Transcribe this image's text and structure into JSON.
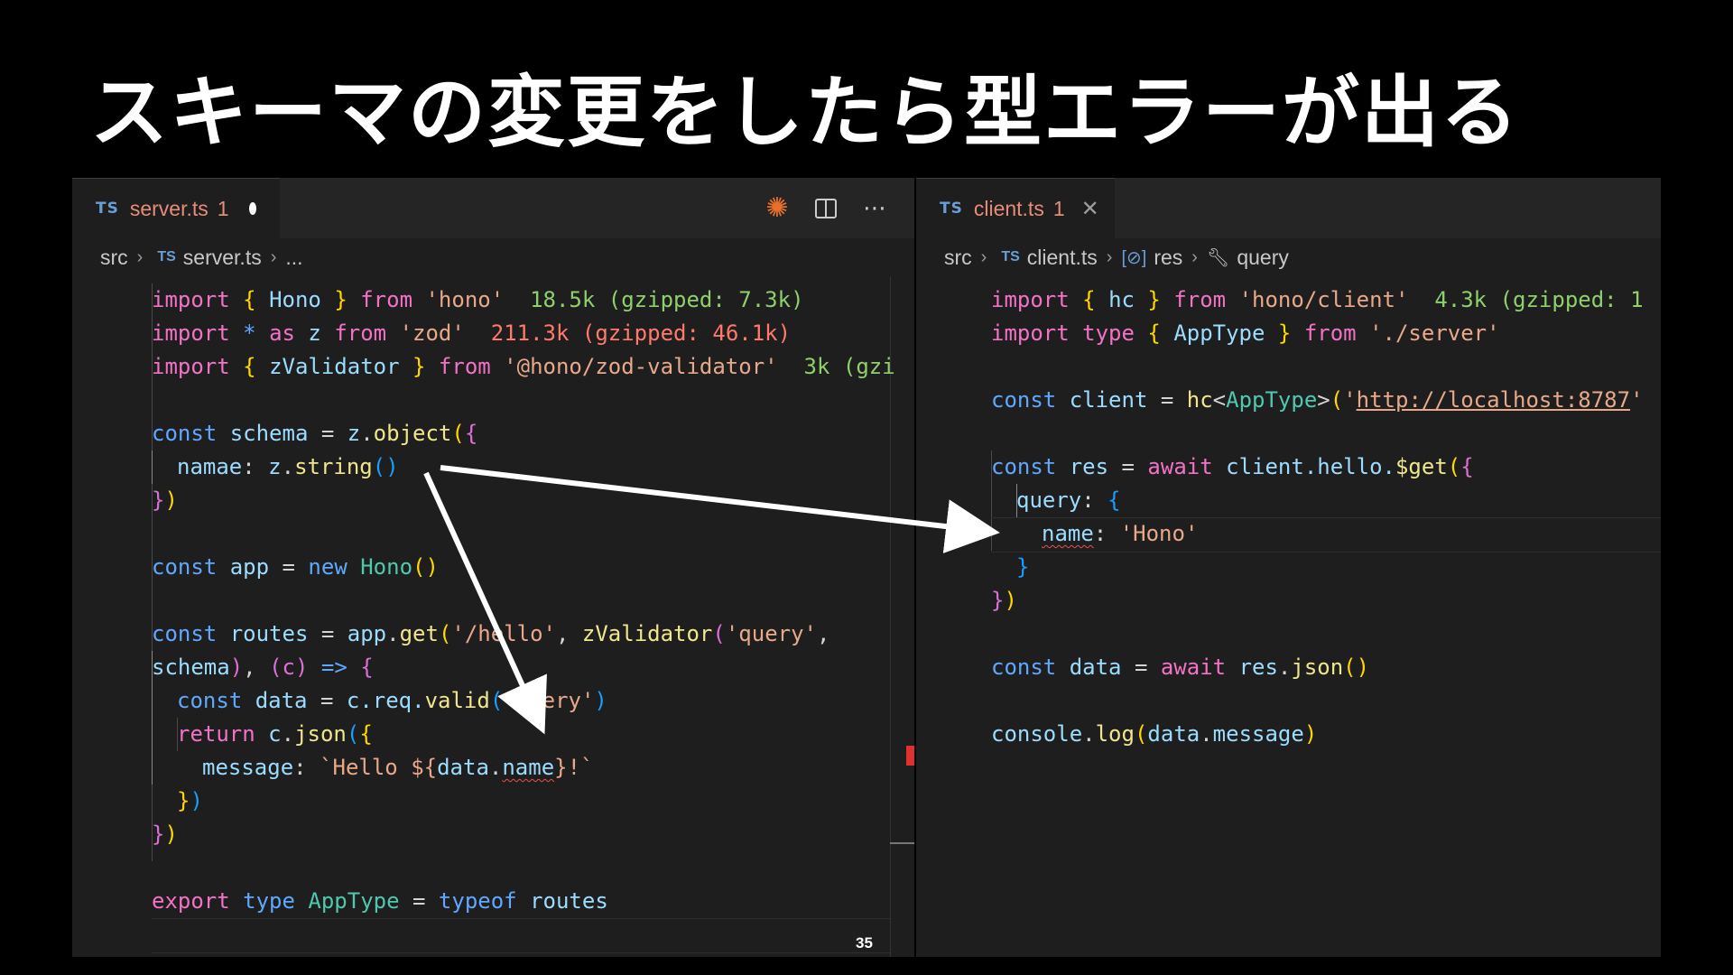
{
  "slide": {
    "title": "スキーマの変更をしたら型エラーが出る",
    "page_number": "35"
  },
  "left_editor": {
    "tab": {
      "lang": "TS",
      "filename": "server.ts",
      "problems": "1",
      "state": "modified"
    },
    "actions": [
      "sparkle-icon",
      "split-editor-icon",
      "more-icon"
    ],
    "breadcrumb": {
      "folder": "src",
      "lang": "TS",
      "file": "server.ts",
      "more": "..."
    },
    "code": {
      "l1": {
        "kw": "import",
        "open": "{",
        "name": "Hono",
        "close": "}",
        "from": "from",
        "module": "'hono'",
        "size": "18.5k (gzipped: 7.3k)"
      },
      "l2": {
        "kw": "import",
        "star": "*",
        "as": "as",
        "name": "z",
        "from": "from",
        "module": "'zod'",
        "size": "211.3k (gzipped: 46.1k)"
      },
      "l3": {
        "kw": "import",
        "open": "{",
        "name": "zValidator",
        "close": "}",
        "from": "from",
        "module": "'@hono/zod-validator'",
        "size": "3k (gzi"
      },
      "l5": {
        "kw": "const",
        "name": "schema",
        "eq": "=",
        "obj": "z",
        "dot": ".",
        "fn": "object",
        "paren": "(",
        "brace": "{"
      },
      "l6": {
        "prop": "namae",
        "colon": ":",
        "obj": "z",
        "dot": ".",
        "fn": "string",
        "parens": "()"
      },
      "l7": {
        "brace": "}",
        "paren": ")"
      },
      "l9": {
        "kw": "const",
        "name": "app",
        "eq": "=",
        "new": "new",
        "cls": "Hono",
        "parens": "()"
      },
      "l11": {
        "kw": "const",
        "name": "routes",
        "eq": "=",
        "obj": "app",
        "dot": ".",
        "fn": "get",
        "paren": "(",
        "path": "'/hello'",
        "comma": ",",
        "fn2": "zValidator",
        "paren2": "(",
        "target": "'query'",
        "comma2": ","
      },
      "l12": {
        "arg": "schema",
        "close": ")",
        "comma": ",",
        "params": "(c)",
        "arrow": "=>",
        "brace": "{"
      },
      "l13": {
        "kw": "const",
        "name": "data",
        "eq": "=",
        "obj": "c",
        "chain": ".req.",
        "fn": "valid",
        "paren": "(",
        "arg": "'query'",
        "close": ")"
      },
      "l14": {
        "kw": "return",
        "obj": "c",
        "dot": ".",
        "fn": "json",
        "paren": "(",
        "brace": "{"
      },
      "l15": {
        "prop": "message",
        "colon": ":",
        "tpl_start": "`Hello ${",
        "obj": "data",
        "dot": ".",
        "err": "name",
        "tpl_end": "}!`"
      },
      "l16": {
        "brace": "}",
        "paren": ")"
      },
      "l17": {
        "brace": "}",
        "paren": ")"
      },
      "l19": {
        "kw": "export",
        "type": "type",
        "name": "AppType",
        "eq": "=",
        "typeof": "typeof",
        "ref": "routes"
      }
    }
  },
  "right_editor": {
    "tab": {
      "lang": "TS",
      "filename": "client.ts",
      "problems": "1",
      "close": "✕"
    },
    "breadcrumb": {
      "folder": "src",
      "lang": "TS",
      "file": "client.ts",
      "sym1": "res",
      "sym2": "query"
    },
    "code": {
      "l1": {
        "kw": "import",
        "open": "{",
        "name": "hc",
        "close": "}",
        "from": "from",
        "module": "'hono/client'",
        "size": "4.3k (gzipped: 1"
      },
      "l2": {
        "kw": "import",
        "type": "type",
        "open": "{",
        "name": "AppType",
        "close": "}",
        "from": "from",
        "module": "'./server'"
      },
      "l4": {
        "kw": "const",
        "name": "client",
        "eq": "=",
        "fn": "hc",
        "lt": "<",
        "type": "AppType",
        "gt": ">",
        "paren": "(",
        "q": "'",
        "url": "http://localhost:8787",
        "q2": "'"
      },
      "l6": {
        "kw": "const",
        "name": "res",
        "eq": "=",
        "await": "await",
        "obj": "client",
        "chain": ".hello.",
        "fn": "$get",
        "paren": "(",
        "brace": "{"
      },
      "l7": {
        "prop": "query",
        "colon": ":",
        "brace": "{"
      },
      "l8": {
        "err": "name",
        "colon": ":",
        "val": "'Hono'"
      },
      "l9": {
        "brace": "}"
      },
      "l10": {
        "brace": "}",
        "paren": ")"
      },
      "l12": {
        "kw": "const",
        "name": "data",
        "eq": "=",
        "await": "await",
        "obj": "res",
        "dot": ".",
        "fn": "json",
        "parens": "()"
      },
      "l14": {
        "obj": "console",
        "dot": ".",
        "fn": "log",
        "paren": "(",
        "arg": "data",
        "dot2": ".",
        "prop": "message",
        "close": ")"
      }
    }
  },
  "colors": {
    "background": "#000000",
    "editor_bg": "#1e1e1e",
    "arrow": "#ffffff",
    "error": "#e85050"
  }
}
